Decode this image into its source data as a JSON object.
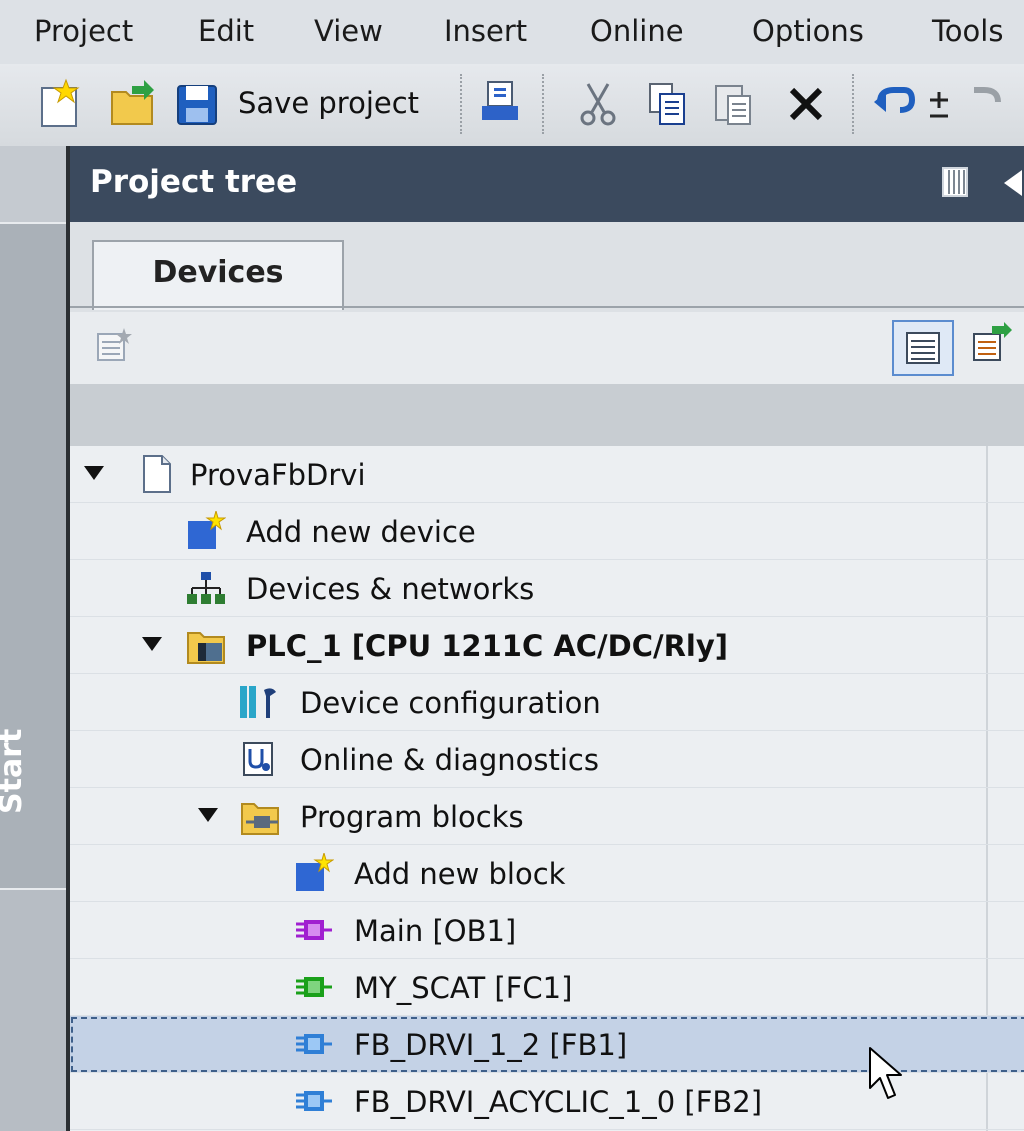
{
  "menu": [
    "Project",
    "Edit",
    "View",
    "Insert",
    "Online",
    "Options",
    "Tools"
  ],
  "toolbar": {
    "save_label": "Save project"
  },
  "start_label": "Start",
  "panel": {
    "title": "Project tree",
    "tab_devices": "Devices"
  },
  "tree": {
    "project": "ProvaFbDrvi",
    "add_device": "Add new device",
    "devices_networks": "Devices & networks",
    "plc": "PLC_1 [CPU 1211C AC/DC/Rly]",
    "device_config": "Device configuration",
    "online_diag": "Online & diagnostics",
    "program_blocks": "Program blocks",
    "add_block": "Add new block",
    "main_ob1": "Main [OB1]",
    "my_scat": "MY_SCAT [FC1]",
    "fb_drvi": "FB_DRVI_1_2 [FB1]",
    "fb_drvi_acyclic": "FB_DRVI_ACYCLIC_1_0 [FB2]"
  },
  "colors": {
    "header": "#3b4a5e",
    "selection": "#c4d2e6",
    "ob_block": "#a020d0",
    "fc_block": "#1aa01a",
    "fb_block": "#2f7fd6"
  }
}
